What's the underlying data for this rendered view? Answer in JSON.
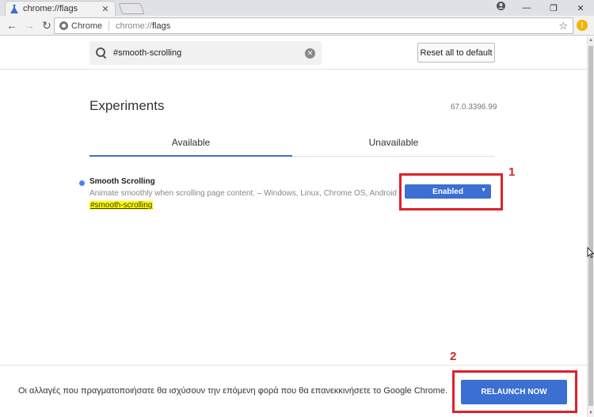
{
  "browser": {
    "tab_title": "chrome://flags",
    "tab_close": "✕",
    "controls": {
      "minimize": "—",
      "maximize": "❐",
      "close": "✕"
    }
  },
  "toolbar": {
    "back": "←",
    "forward": "→",
    "reload": "↻",
    "chip_label": "Chrome",
    "url_scheme": "chrome://",
    "url_path": "flags",
    "star": "☆",
    "extension_badge": "!"
  },
  "search": {
    "value": "#smooth-scrolling",
    "placeholder": "Search flags",
    "clear": "✕"
  },
  "reset_button": "Reset all to default",
  "page_title": "Experiments",
  "version": "67.0.3396.99",
  "tabs": [
    {
      "label": "Available",
      "active": true
    },
    {
      "label": "Unavailable",
      "active": false
    }
  ],
  "flag": {
    "name": "Smooth Scrolling",
    "description": "Animate smoothly when scrolling page content. – Windows, Linux, Chrome OS, Android",
    "hash": "#smooth-scrolling",
    "selected": "Enabled",
    "arrow": "▼"
  },
  "annotations": {
    "one": "1",
    "two": "2"
  },
  "footer": {
    "message": "Οι αλλαγές που πραγματοποιήσατε θα ισχύσουν την επόμενη φορά που θα επανεκκινήσετε το Google Chrome.",
    "relaunch_button": "RELAUNCH NOW"
  },
  "colors": {
    "accent": "#3b6fd2",
    "annotation": "#e0202a",
    "highlight": "#ffff00"
  }
}
